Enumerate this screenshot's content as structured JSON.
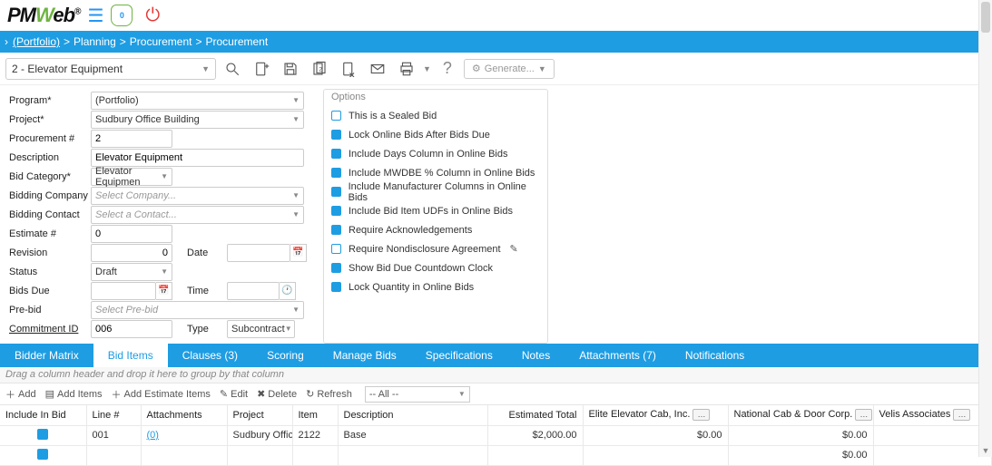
{
  "header": {
    "brand_pre": "PM",
    "brand_w": "W",
    "brand_post": "eb",
    "brand_r": "®",
    "shield_count": "0"
  },
  "breadcrumb": {
    "portfolio": "(Portfolio)",
    "p1": "Planning",
    "p2": "Procurement",
    "p3": "Procurement"
  },
  "record": {
    "name": "2 - Elevator Equipment",
    "generate": "Generate..."
  },
  "form": {
    "labels": {
      "program": "Program",
      "project": "Project",
      "procurement_no": "Procurement #",
      "description": "Description",
      "bid_category": "Bid Category",
      "bidding_company": "Bidding Company",
      "bidding_contact": "Bidding Contact",
      "estimate_no": "Estimate #",
      "revision": "Revision",
      "date": "Date",
      "status": "Status",
      "bids_due": "Bids Due",
      "time": "Time",
      "prebid": "Pre-bid",
      "commitment_id": "Commitment ID",
      "type": "Type"
    },
    "values": {
      "program": "(Portfolio)",
      "project": "Sudbury Office Building",
      "procurement_no": "2",
      "description": "Elevator Equipment",
      "bid_category": "Elevator Equipmen",
      "bidding_company_ph": "Select Company...",
      "bidding_contact_ph": "Select a Contact...",
      "estimate_no": "0",
      "revision": "0",
      "date": "",
      "status": "Draft",
      "bids_due": "",
      "time": "",
      "prebid_ph": "Select Pre-bid",
      "commitment_id": "006",
      "type": "Subcontract"
    }
  },
  "options": {
    "header": "Options",
    "items": [
      {
        "label": "This is a Sealed Bid",
        "checked": false
      },
      {
        "label": "Lock Online Bids After Bids Due",
        "checked": true
      },
      {
        "label": "Include Days Column in Online Bids",
        "checked": true
      },
      {
        "label": "Include MWDBE % Column in Online Bids",
        "checked": true
      },
      {
        "label": "Include Manufacturer Columns in Online Bids",
        "checked": true
      },
      {
        "label": "Include Bid Item UDFs in Online Bids",
        "checked": true
      },
      {
        "label": "Require Acknowledgements",
        "checked": true
      },
      {
        "label": "Require Nondisclosure Agreement",
        "checked": false,
        "pencil": true
      },
      {
        "label": "Show Bid Due Countdown Clock",
        "checked": true
      },
      {
        "label": "Lock Quantity in Online Bids",
        "checked": true
      }
    ]
  },
  "tabs": [
    "Bidder Matrix",
    "Bid Items",
    "Clauses (3)",
    "Scoring",
    "Manage Bids",
    "Specifications",
    "Notes",
    "Attachments (7)",
    "Notifications"
  ],
  "group_hint": "Drag a column header and drop it here to group by that column",
  "grid_toolbar": {
    "add": "Add",
    "add_items": "Add Items",
    "add_estimate": "Add Estimate Items",
    "edit": "Edit",
    "delete": "Delete",
    "refresh": "Refresh",
    "filter": "-- All --"
  },
  "grid": {
    "columns": [
      "Include In Bid",
      "Line #",
      "Attachments",
      "Project",
      "Item",
      "Description",
      "Estimated Total",
      "Elite Elevator Cab, Inc.",
      "National Cab & Door Corp.",
      "Velis Associates"
    ],
    "rows": [
      {
        "include": true,
        "line": "001",
        "attachments": "(0)",
        "project": "Sudbury Office",
        "item": "2122",
        "description": "Base",
        "estimated": "$2,000.00",
        "c1": "$0.00",
        "c2": "$0.00",
        "c3": ""
      },
      {
        "include": true,
        "line": "",
        "attachments": "",
        "project": "",
        "item": "",
        "description": "",
        "estimated": "",
        "c1": "",
        "c2": "$0.00",
        "c3": ""
      }
    ]
  },
  "chart_data": {
    "type": "table",
    "columns": [
      "Include In Bid",
      "Line #",
      "Attachments",
      "Project",
      "Item",
      "Description",
      "Estimated Total",
      "Elite Elevator Cab, Inc.",
      "National Cab & Door Corp.",
      "Velis Associates"
    ],
    "rows": [
      [
        true,
        "001",
        "(0)",
        "Sudbury Office",
        "2122",
        "Base",
        "$2,000.00",
        "$0.00",
        "$0.00",
        ""
      ]
    ]
  }
}
